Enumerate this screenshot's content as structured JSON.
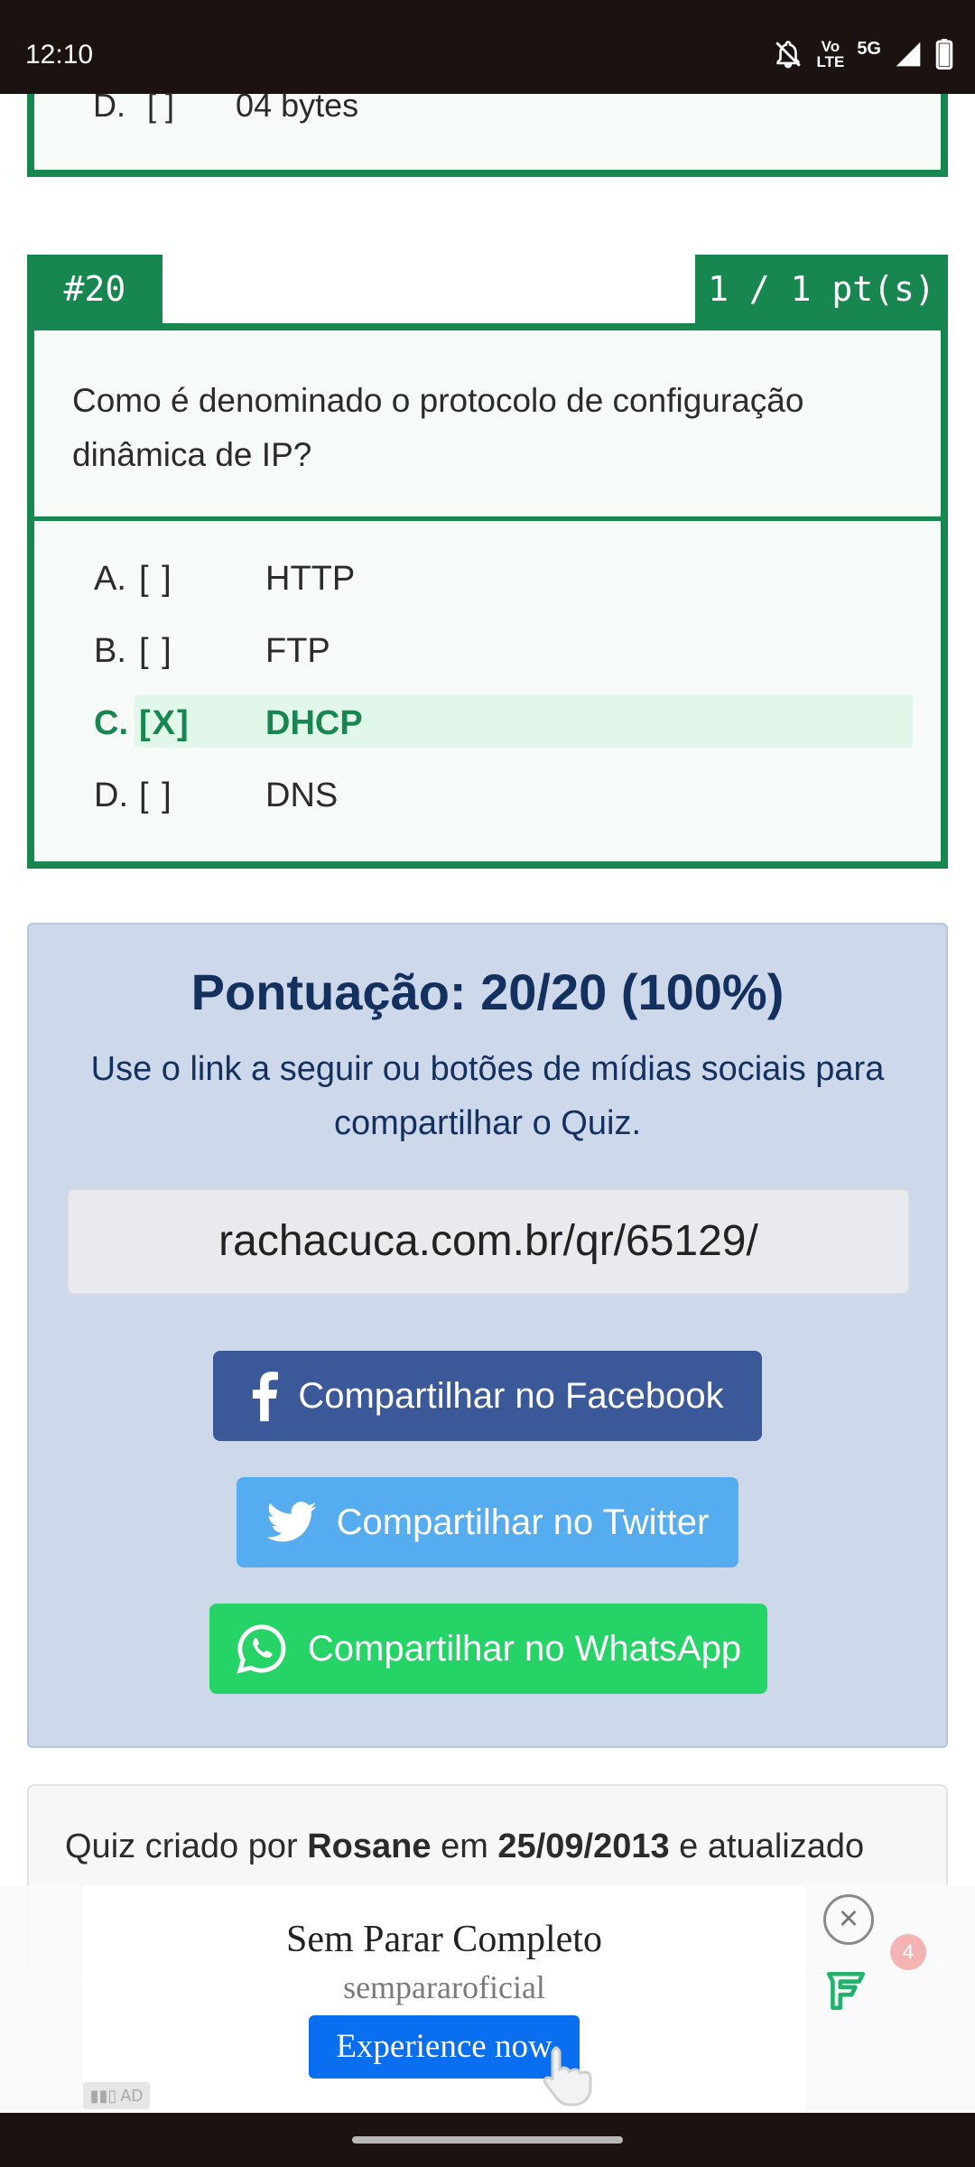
{
  "status_bar": {
    "time": "12:10",
    "volte_top": "Vo",
    "volte_bottom": "LTE",
    "network": "5G",
    "icons": [
      "notifications-off-icon",
      "volte-icon",
      "signal-icon",
      "battery-icon"
    ]
  },
  "previous_question": {
    "option": {
      "letter": "D.",
      "box": "[ ]",
      "text": "04 bytes"
    }
  },
  "question": {
    "number": "#20",
    "score": "1 / 1 pt(s)",
    "text": "Como é denominado o protocolo de configuração dinâmica de IP?",
    "options": [
      {
        "letter": "A.",
        "box": "[ ]",
        "text": "HTTP",
        "selected": false
      },
      {
        "letter": "B.",
        "box": "[ ]",
        "text": "FTP",
        "selected": false
      },
      {
        "letter": "C.",
        "box": "[X]",
        "text": "DHCP",
        "selected": true
      },
      {
        "letter": "D.",
        "box": "[ ]",
        "text": "DNS",
        "selected": false
      }
    ]
  },
  "score_panel": {
    "title": "Pontuação: 20/20 (100%)",
    "subtitle": "Use o link a seguir ou botões de mídias sociais para compartilhar o Quiz.",
    "link": "rachacuca.com.br/qr/65129/",
    "buttons": {
      "facebook": "Compartilhar no Facebook",
      "twitter": "Compartilhar no Twitter",
      "whatsapp": "Compartilhar no WhatsApp"
    }
  },
  "author": {
    "prefix": "Quiz criado por ",
    "name": "Rosane",
    "middle": " em ",
    "date": "25/09/2013",
    "suffix": " e atualizado"
  },
  "ad": {
    "title": "Sem Parar Completo",
    "brand": "sempararoficial",
    "cta": "Experience now",
    "label": "AD",
    "badge": "4"
  },
  "colors": {
    "green": "#17864f",
    "panel": "#cdd8ea",
    "facebook": "#3b5998",
    "twitter": "#55acee",
    "whatsapp": "#25d366"
  }
}
